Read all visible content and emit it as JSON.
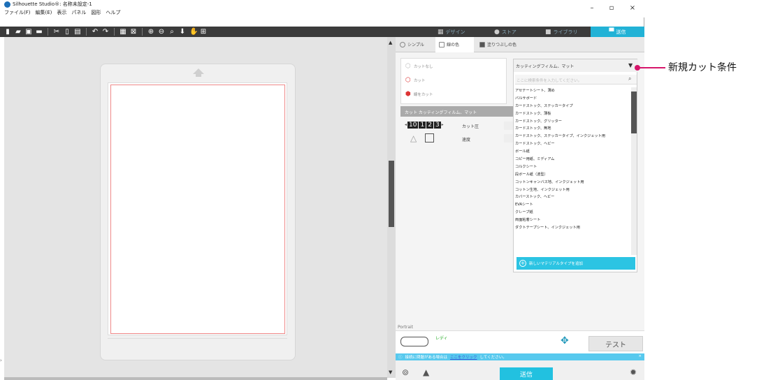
{
  "window": {
    "title": "Silhouette Studio®: 名称未設定-1",
    "menu": [
      "ファイル(F)",
      "編集(E)",
      "表示",
      "パネル",
      "図形",
      "ヘルプ"
    ]
  },
  "nav_tabs": [
    "デザイン",
    "ストア",
    "ライブラリ",
    "送信"
  ],
  "panel_tabs": [
    "シンプル",
    "線の色",
    "塗りつぶしの色"
  ],
  "cut_options": [
    "カットなし",
    "カット",
    "線をカット"
  ],
  "material_header": "カット カッティングフィルム、マット",
  "settings": {
    "blade_digits": [
      "10",
      "1",
      "2",
      "3"
    ],
    "force_label": "カット圧",
    "speed_label": "速度"
  },
  "dropdown": {
    "selected": "カッティングフィルム、マット",
    "search_placeholder": "ここに検索条件を入力してください。",
    "items": [
      "アセテートシート、薄め",
      "バルサボード",
      "カードストック、ステッカータイプ",
      "カードストック、薄板",
      "カードストック、グリッター",
      "カードストック、無地",
      "カードストック、ステッカータイプ、インクジェット用",
      "カードストック、ヘビー",
      "ボール紙",
      "コピー用紙、ミディアム",
      "コルクシート",
      "段ボール紙（波型）",
      "コットンキャンバス地、インクジェット用",
      "コットン生地、インクジェット用",
      "カバーストック、ヘビー",
      "EVAシート",
      "クレープ紙",
      "両面粘着シート",
      "ダクトテープシート、インクジェット用"
    ],
    "add_label": "新しいマテリアルタイプを追加"
  },
  "status": {
    "portrait_label": "Portrait",
    "ready": "レディ",
    "test_label": "テスト",
    "info_prefix": "接続に問題がある場合は",
    "info_link": "ここをクリック",
    "info_suffix": "してください。",
    "send_label": "送信"
  },
  "callout": "新規カット条件",
  "colors": {
    "accent": "#22b2d6",
    "callout": "#d6166b",
    "cut_line": "#ee8888"
  }
}
